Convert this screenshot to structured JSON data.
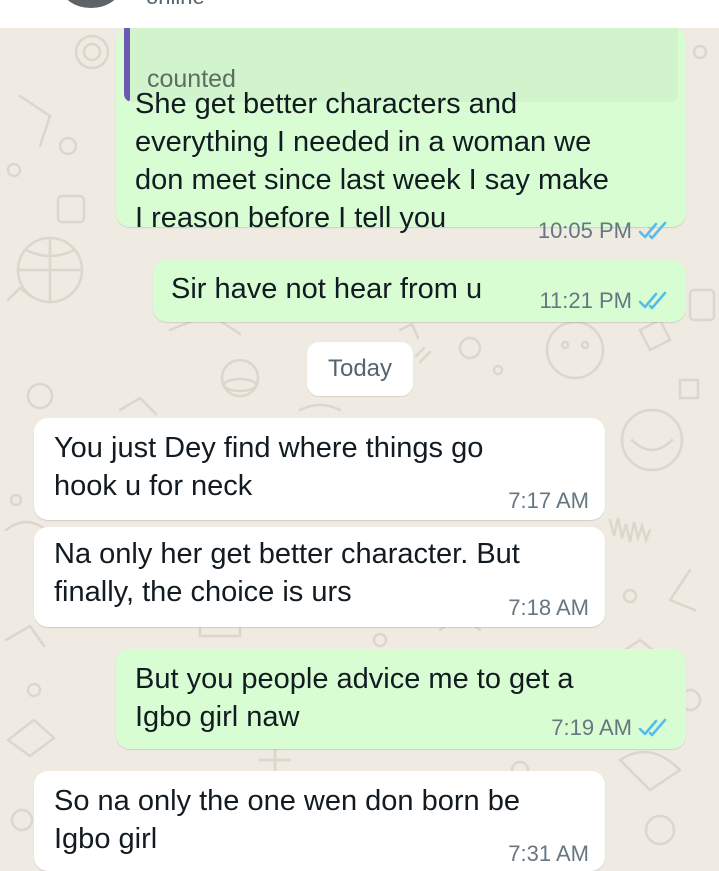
{
  "header": {
    "status": "online"
  },
  "date_divider": "Today",
  "messages": [
    {
      "direction": "out",
      "quoted": "counted",
      "lines": [
        "She get better characters and",
        "everything I needed in a woman we",
        "don meet since last week I say make",
        "I reason before I tell you"
      ],
      "time": "10:05 PM",
      "read": true
    },
    {
      "direction": "out",
      "lines": [
        "Sir have not hear from u"
      ],
      "time": "11:21 PM",
      "read": true
    },
    {
      "direction": "in",
      "lines": [
        "You just Dey find where things go",
        "hook u for neck"
      ],
      "time": "7:17 AM"
    },
    {
      "direction": "in",
      "lines": [
        "Na only her get better character. But",
        "finally, the choice is urs"
      ],
      "time": "7:18 AM"
    },
    {
      "direction": "out",
      "lines": [
        "But you people advice me to get a",
        "Igbo girl naw"
      ],
      "time": "7:19 AM",
      "read": true
    },
    {
      "direction": "in",
      "lines": [
        "So na only the one wen don born be",
        "Igbo girl"
      ],
      "time": "7:31 AM"
    }
  ],
  "colors": {
    "outgoing_bubble": "#d9fdd3",
    "incoming_bubble": "#ffffff",
    "read_ticks": "#53bdeb",
    "quote_bar": "#6b5ab4"
  },
  "icons": {
    "read_receipt": "double-check-icon"
  }
}
